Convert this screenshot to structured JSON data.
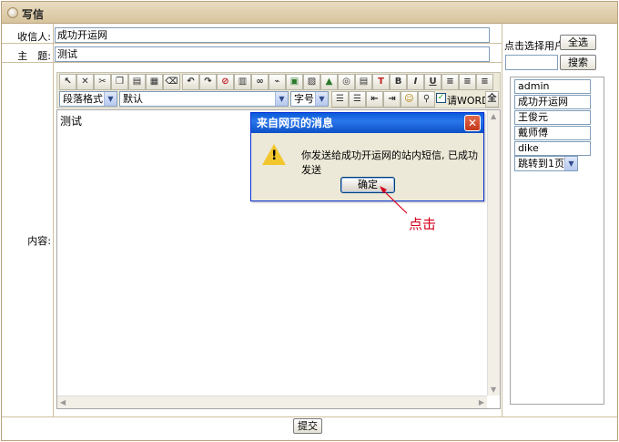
{
  "page": {
    "title": "写信"
  },
  "form": {
    "recipient_label": "收信人:",
    "recipient_value": "成功开运网",
    "subject_label": "主　题:",
    "subject_value": "测试",
    "content_label": "内容:",
    "content_value": "测试",
    "submit_label": "提交"
  },
  "toolbar": {
    "paragraph_format": "段落格式",
    "font_name": "默认",
    "font_size": "字号",
    "word_checkbox_label": "请WORD",
    "fullscreen_label": "全",
    "bold_label": "B",
    "italic_label": "I",
    "underline_label": "U"
  },
  "side": {
    "pick_label": "点击选择用户",
    "select_all_label": "全选",
    "search_label": "搜索",
    "users": [
      "admin",
      "成功开运网",
      "王俊元",
      "戴师傅",
      "dike"
    ],
    "page_jump": "跳转到1页"
  },
  "dialog": {
    "title": "来自网页的消息",
    "message": "你发送给成功开运网的站内短信, 已成功发送",
    "ok_label": "确定"
  },
  "annotation": "点击",
  "colors": {
    "accent": "#0a5bd8",
    "annotation": "#d6001c",
    "header": "#d8c49d"
  }
}
